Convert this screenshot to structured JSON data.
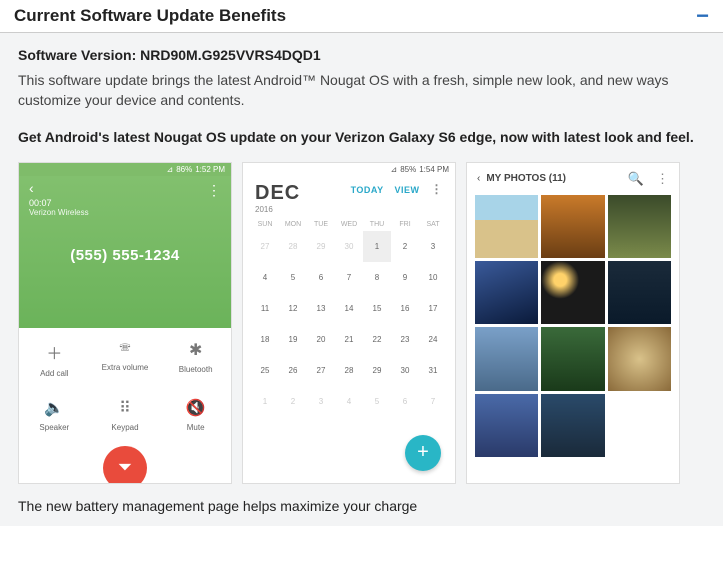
{
  "section": {
    "title": "Current Software Update Benefits",
    "collapse_glyph": "−"
  },
  "version_line": "Software Version: NRD90M.G925VVRS4DQD1",
  "description": "This software update brings the latest Android™ Nougat OS with a fresh, simple new look, and new ways customize your device and contents.",
  "subheading": "Get Android's latest Nougat OS update on your Verizon Galaxy S6 edge, now with latest look and feel.",
  "phone_screen": {
    "status": {
      "signal": "⊿",
      "battery_pct": "86%",
      "time": "1:52 PM"
    },
    "back_glyph": "‹",
    "more_glyph": "⋮",
    "timer": "00:07",
    "carrier": "Verizon Wireless",
    "number": "(555) 555-1234",
    "actions": [
      {
        "icon": "＋",
        "label": "Add call"
      },
      {
        "icon": "🕾",
        "label": "Extra volume"
      },
      {
        "icon": "✱",
        "label": "Bluetooth"
      },
      {
        "icon": "🔈",
        "label": "Speaker"
      },
      {
        "icon": "⠿",
        "label": "Keypad"
      },
      {
        "icon": "🔇",
        "label": "Mute"
      }
    ],
    "hangup_glyph": "⏷"
  },
  "calendar_screen": {
    "status": {
      "signal": "⊿",
      "battery_pct": "85%",
      "time": "1:54 PM"
    },
    "month": "DEC",
    "year": "2016",
    "link_today": "TODAY",
    "link_view": "VIEW",
    "more_glyph": "⋮",
    "dow": [
      "SUN",
      "MON",
      "TUE",
      "WED",
      "THU",
      "FRI",
      "SAT"
    ],
    "cells": [
      {
        "n": "27",
        "faded": true
      },
      {
        "n": "28",
        "faded": true
      },
      {
        "n": "29",
        "faded": true
      },
      {
        "n": "30",
        "faded": true
      },
      {
        "n": "1",
        "sel": true
      },
      {
        "n": "2"
      },
      {
        "n": "3"
      },
      {
        "n": "4"
      },
      {
        "n": "5"
      },
      {
        "n": "6"
      },
      {
        "n": "7"
      },
      {
        "n": "8"
      },
      {
        "n": "9"
      },
      {
        "n": "10"
      },
      {
        "n": "11"
      },
      {
        "n": "12"
      },
      {
        "n": "13"
      },
      {
        "n": "14"
      },
      {
        "n": "15"
      },
      {
        "n": "16"
      },
      {
        "n": "17"
      },
      {
        "n": "18"
      },
      {
        "n": "19"
      },
      {
        "n": "20"
      },
      {
        "n": "21"
      },
      {
        "n": "22"
      },
      {
        "n": "23"
      },
      {
        "n": "24"
      },
      {
        "n": "25"
      },
      {
        "n": "26"
      },
      {
        "n": "27"
      },
      {
        "n": "28"
      },
      {
        "n": "29"
      },
      {
        "n": "30"
      },
      {
        "n": "31"
      },
      {
        "n": "1",
        "faded": true
      },
      {
        "n": "2",
        "faded": true
      },
      {
        "n": "3",
        "faded": true
      },
      {
        "n": "4",
        "faded": true
      },
      {
        "n": "5",
        "faded": true
      },
      {
        "n": "6",
        "faded": true
      },
      {
        "n": "7",
        "faded": true
      }
    ],
    "fab_glyph": "+"
  },
  "gallery_screen": {
    "back_glyph": "‹",
    "title": "MY PHOTOS (11)",
    "search_glyph": "🔍",
    "more_glyph": "⋮"
  },
  "footer": "The new battery management page helps maximize your charge"
}
